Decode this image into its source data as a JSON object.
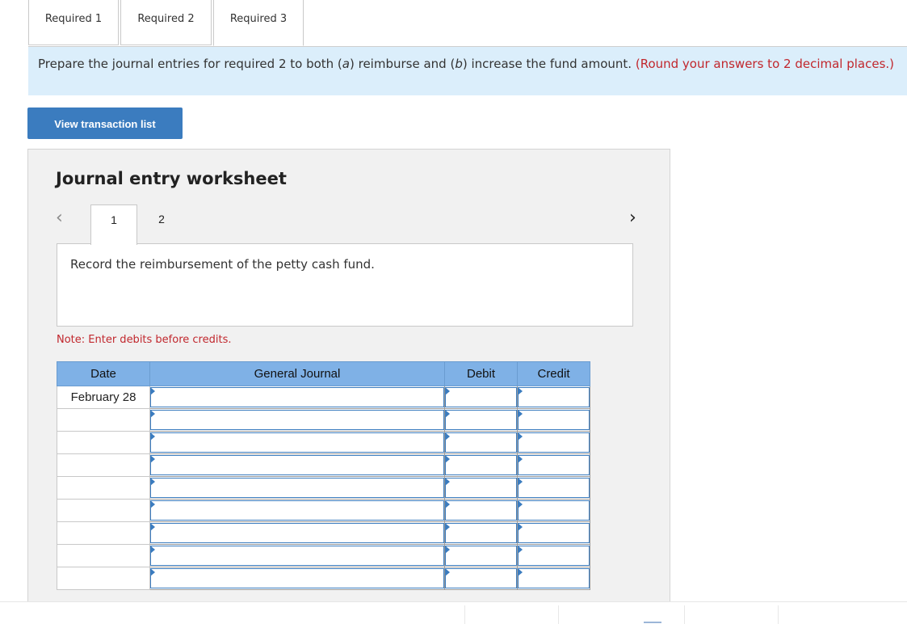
{
  "tabs": [
    {
      "label": "Required 1"
    },
    {
      "label": "Required 2"
    },
    {
      "label": "Required 3"
    }
  ],
  "instructions": {
    "pre": "Prepare the journal entries for required 2 to both (",
    "a": "a",
    "mid1": ") reimburse and (",
    "b": "b",
    "mid2": ") increase the fund amount. ",
    "note": "(Round your answers to 2 decimal places.)"
  },
  "view_button": "View transaction list",
  "worksheet": {
    "title": "Journal entry worksheet",
    "pages": [
      "1",
      "2"
    ],
    "prompt": "Record the reimbursement of the petty cash fund.",
    "note": "Note: Enter debits before credits."
  },
  "table": {
    "headers": {
      "date": "Date",
      "journal": "General Journal",
      "debit": "Debit",
      "credit": "Credit"
    },
    "rows": [
      {
        "date": "February 28",
        "account": "",
        "debit": "",
        "credit": ""
      },
      {
        "date": "",
        "account": "",
        "debit": "",
        "credit": ""
      },
      {
        "date": "",
        "account": "",
        "debit": "",
        "credit": ""
      },
      {
        "date": "",
        "account": "",
        "debit": "",
        "credit": ""
      },
      {
        "date": "",
        "account": "",
        "debit": "",
        "credit": ""
      },
      {
        "date": "",
        "account": "",
        "debit": "",
        "credit": ""
      },
      {
        "date": "",
        "account": "",
        "debit": "",
        "credit": ""
      },
      {
        "date": "",
        "account": "",
        "debit": "",
        "credit": ""
      },
      {
        "date": "",
        "account": "",
        "debit": "",
        "credit": ""
      }
    ]
  },
  "colors": {
    "accent": "#3b7cbf",
    "header_bg": "#7fb1e6",
    "info_bg": "#dbeefb",
    "warning": "#c1272d"
  }
}
